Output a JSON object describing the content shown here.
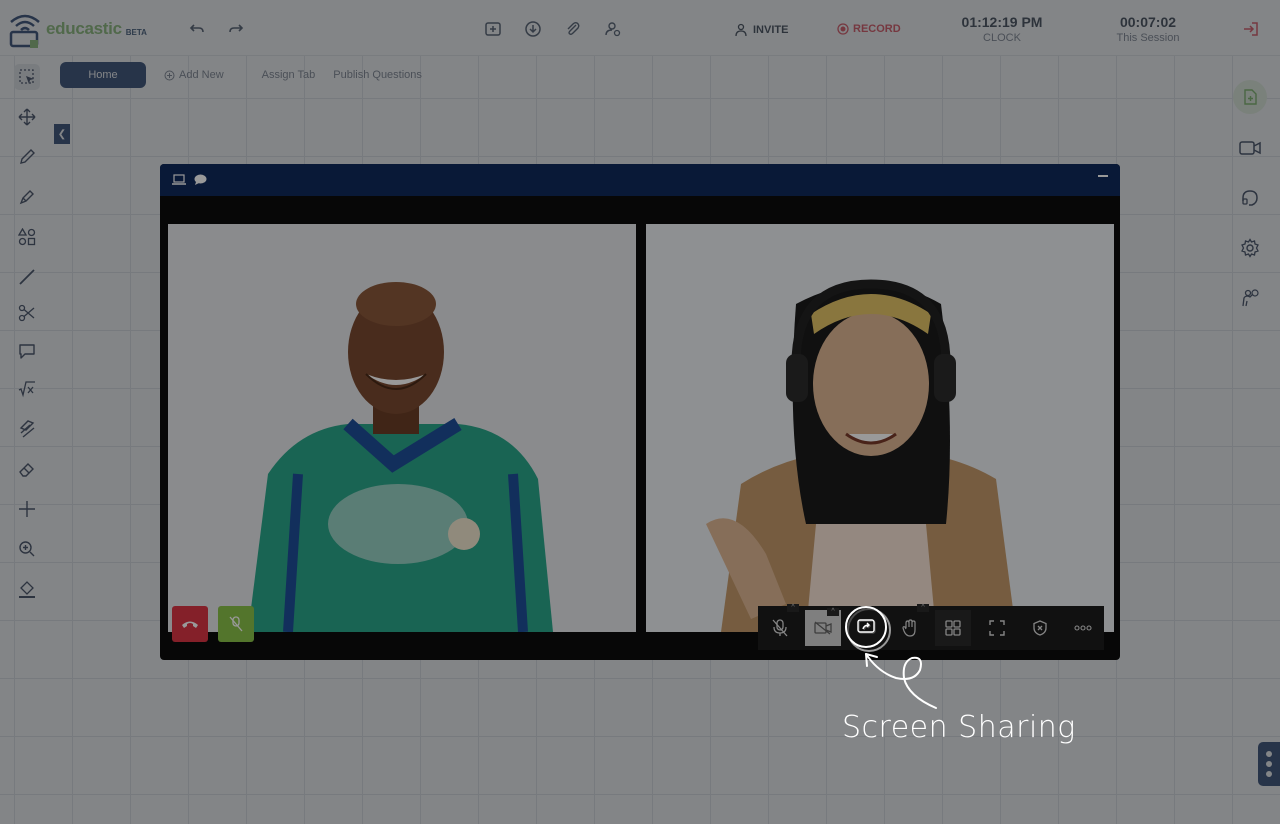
{
  "app": {
    "brand": "educastic",
    "brand_badge": "BETA"
  },
  "header": {
    "invite_label": "INVITE",
    "record_label": "RECORD",
    "clock_time": "01:12:19 PM",
    "clock_label": "CLOCK",
    "session_time": "00:07:02",
    "session_label": "This Session"
  },
  "tabs": {
    "home": "Home",
    "add_new": "Add New",
    "assign_tab": "Assign Tab",
    "publish_questions": "Publish Questions"
  },
  "left_toolbar": [
    "select-icon",
    "move-icon",
    "pen-icon",
    "highlighter-icon",
    "shapes-icon",
    "line-icon",
    "scissors-icon",
    "comment-icon",
    "formula-icon",
    "eraser-stroke-icon",
    "eraser-icon",
    "crosshair-icon",
    "zoom-icon",
    "fill-icon"
  ],
  "right_toolbar": [
    "add-page-icon",
    "video-camera-icon",
    "headset-icon",
    "settings-icon",
    "raise-hand-icon"
  ],
  "video": {
    "controls": [
      "mic-off-icon",
      "camera-off-icon",
      "screen-share-icon",
      "raise-hand-icon",
      "grid-view-icon",
      "fullscreen-icon",
      "shield-icon",
      "more-icon"
    ]
  },
  "annotation": {
    "label": "Screen Sharing"
  },
  "colors": {
    "navy": "#0f2a5c",
    "brand_green": "#7bb662",
    "record_red": "#dc3545",
    "mic_green": "#8bc34a"
  }
}
